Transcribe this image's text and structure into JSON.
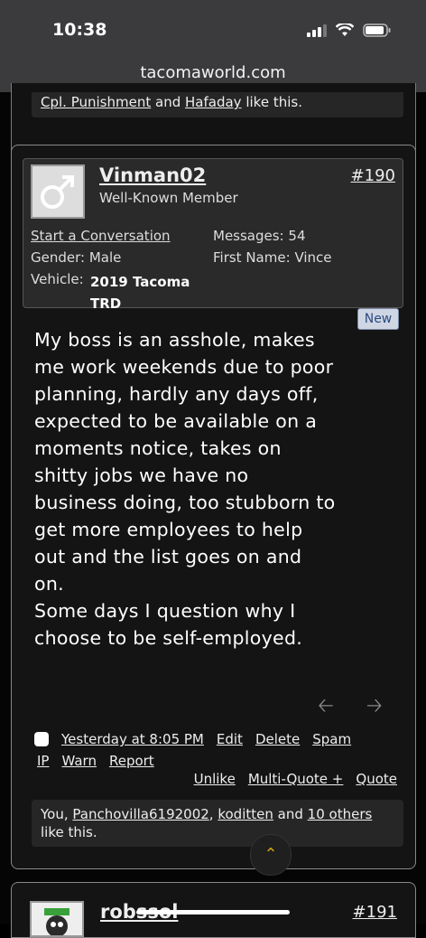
{
  "status": {
    "time": "10:38"
  },
  "browser": {
    "url": "tacomaworld.com"
  },
  "prev_post": {
    "likes": {
      "user1": "Cpl. Punishment",
      "and": "and",
      "user2": "Hafaday",
      "suffix": "like this."
    }
  },
  "post": {
    "username": "Vinman02",
    "user_title": "Well-Known Member",
    "post_number": "#190",
    "start_conversation": "Start a Conversation",
    "messages_label": "Messages:",
    "messages_value": "54",
    "gender_label": "Gender:",
    "gender_value": "Male",
    "first_name_label": "First Name:",
    "first_name_value": "Vince",
    "vehicle_label": "Vehicle:",
    "vehicle_line1": "2019 Tacoma",
    "vehicle_line2": "TRD",
    "new_badge": "New",
    "message_lines": [
      "My boss is an asshole, makes",
      "me work weekends due to poor",
      "planning, hardly any days off,",
      "expected to be available on a",
      "moments notice, takes on",
      "shitty jobs we have no",
      "business doing, too stubborn to",
      "get more employees to help",
      "out and the list goes on and",
      "on.",
      "Some days I question why I",
      "choose to be self-employed."
    ],
    "timestamp": "Yesterday at 8:05 PM",
    "actions": {
      "edit": "Edit",
      "delete": "Delete",
      "spam": "Spam",
      "ip": "IP",
      "warn": "Warn",
      "report": "Report",
      "unlike": "Unlike",
      "multi_quote": "Multi-Quote +",
      "quote": "Quote"
    },
    "likes": {
      "you": "You,",
      "user1": "Panchovilla6192002",
      "user2": "koditten",
      "and": "and",
      "others": "10 others",
      "suffix": "like this."
    }
  },
  "next_post": {
    "username": "robssol",
    "post_number": "#191"
  }
}
